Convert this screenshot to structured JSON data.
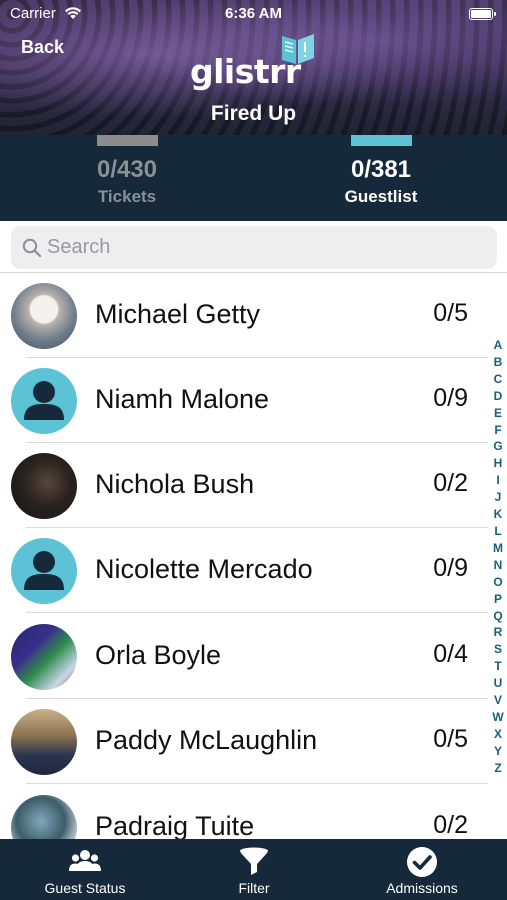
{
  "status_bar": {
    "carrier": "Carrier",
    "time": "6:36 AM"
  },
  "header": {
    "back_label": "Back",
    "logo_text": "glistrr",
    "event_title": "Fired Up"
  },
  "counters": {
    "tickets": {
      "value": "0/430",
      "label": "Tickets"
    },
    "guestlist": {
      "value": "0/381",
      "label": "Guestlist"
    }
  },
  "search": {
    "placeholder": "Search",
    "value": ""
  },
  "guests": [
    {
      "name": "Michael Getty",
      "count": "0/5",
      "avatar": "photo"
    },
    {
      "name": "Niamh Malone",
      "count": "0/9",
      "avatar": "default-person-icon"
    },
    {
      "name": "Nichola Bush",
      "count": "0/2",
      "avatar": "photo"
    },
    {
      "name": "Nicolette Mercado",
      "count": "0/9",
      "avatar": "default-person-icon"
    },
    {
      "name": "Orla Boyle",
      "count": "0/4",
      "avatar": "photo"
    },
    {
      "name": "Paddy McLaughlin",
      "count": "0/5",
      "avatar": "photo"
    },
    {
      "name": "Padraig Tuite",
      "count": "0/2",
      "avatar": "photo"
    }
  ],
  "alphabet": [
    "A",
    "B",
    "C",
    "D",
    "E",
    "F",
    "G",
    "H",
    "I",
    "J",
    "K",
    "L",
    "M",
    "N",
    "O",
    "P",
    "Q",
    "R",
    "S",
    "T",
    "U",
    "V",
    "W",
    "X",
    "Y",
    "Z"
  ],
  "tabs": [
    {
      "label": "Guest Status",
      "icon": "users-icon"
    },
    {
      "label": "Filter",
      "icon": "filter-icon"
    },
    {
      "label": "Admissions",
      "icon": "check-circle-icon"
    }
  ],
  "colors": {
    "accent": "#5cc2d6",
    "dark_bar": "#15293a",
    "index_text": "#1a5f7a"
  }
}
